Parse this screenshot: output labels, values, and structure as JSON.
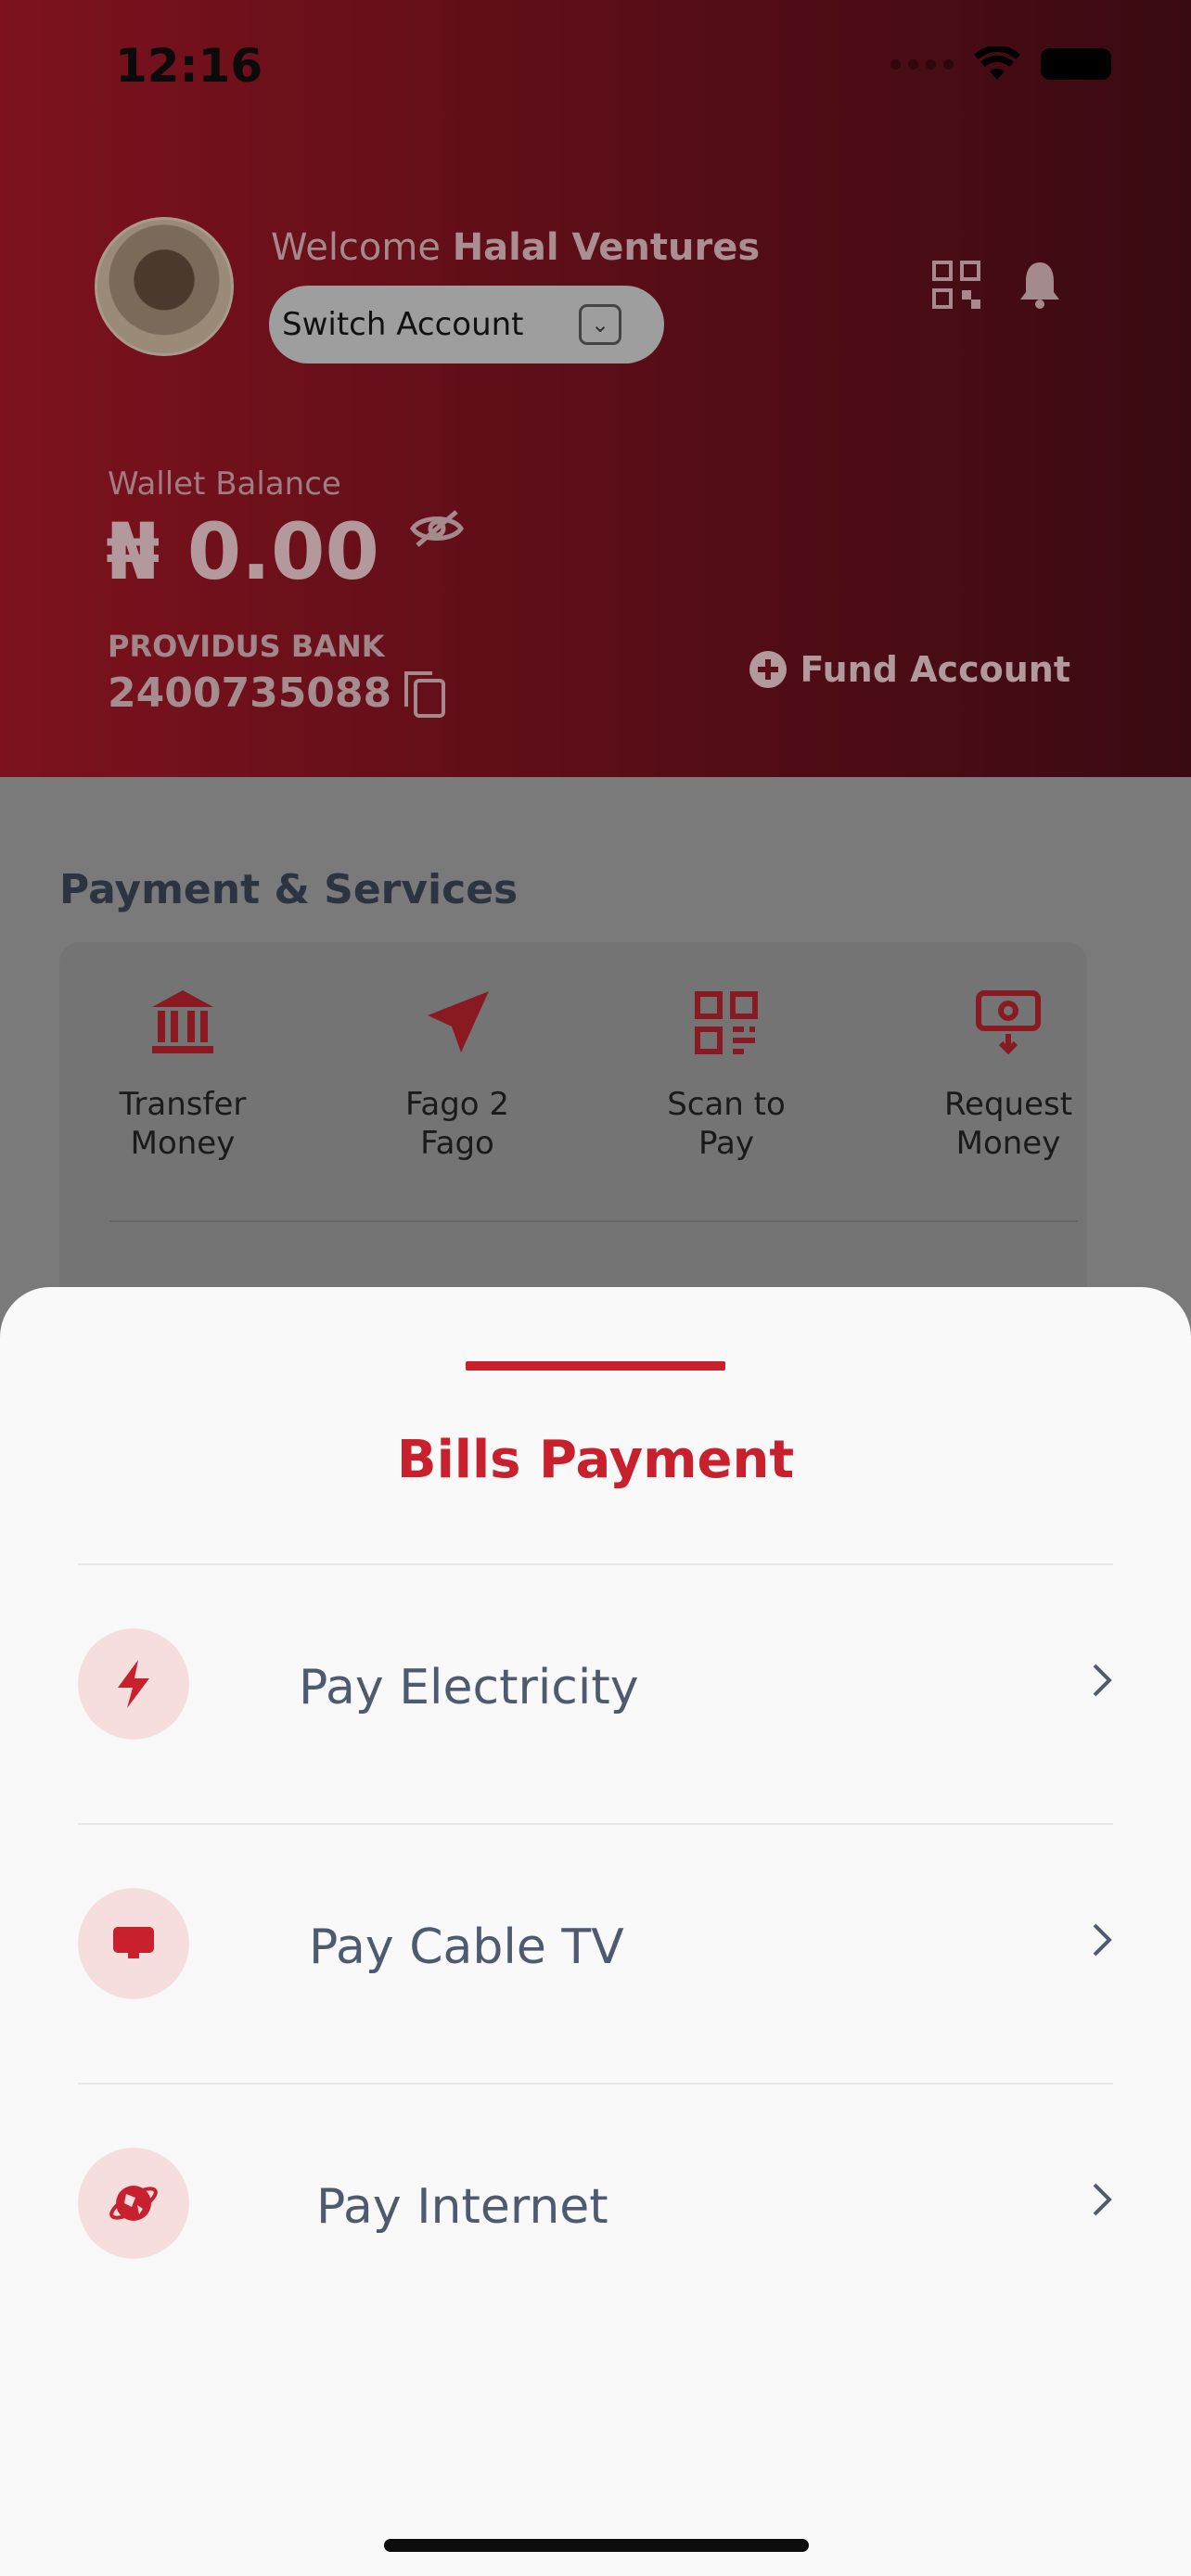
{
  "status_bar": {
    "time": "12:16"
  },
  "header": {
    "welcome_prefix": "Welcome",
    "business_name": "Halal Ventures",
    "switch_account_label": "Switch Account",
    "wallet_label": "Wallet Balance",
    "wallet_amount": "₦ 0.00",
    "bank_name": "PROVIDUS BANK",
    "account_number": "2400735088",
    "fund_label": "Fund Account"
  },
  "services": {
    "title": "Payment & Services",
    "items": [
      {
        "label": "Transfer\nMoney",
        "icon": "bank-icon"
      },
      {
        "label": "Fago 2\nFago",
        "icon": "send-icon"
      },
      {
        "label": "Scan to\nPay",
        "icon": "qr-scan-icon"
      },
      {
        "label": "Request\nMoney",
        "icon": "cash-request-icon"
      }
    ]
  },
  "sheet": {
    "title": "Bills Payment",
    "options": [
      {
        "label": "Pay Electricity",
        "icon": "lightning-icon"
      },
      {
        "label": "Pay Cable TV",
        "icon": "tv-icon"
      },
      {
        "label": "Pay Internet",
        "icon": "globe-icon"
      }
    ]
  },
  "colors": {
    "accent": "#C8202C",
    "icon_bg": "#F6DEDE",
    "row_text": "#4D5A70"
  }
}
